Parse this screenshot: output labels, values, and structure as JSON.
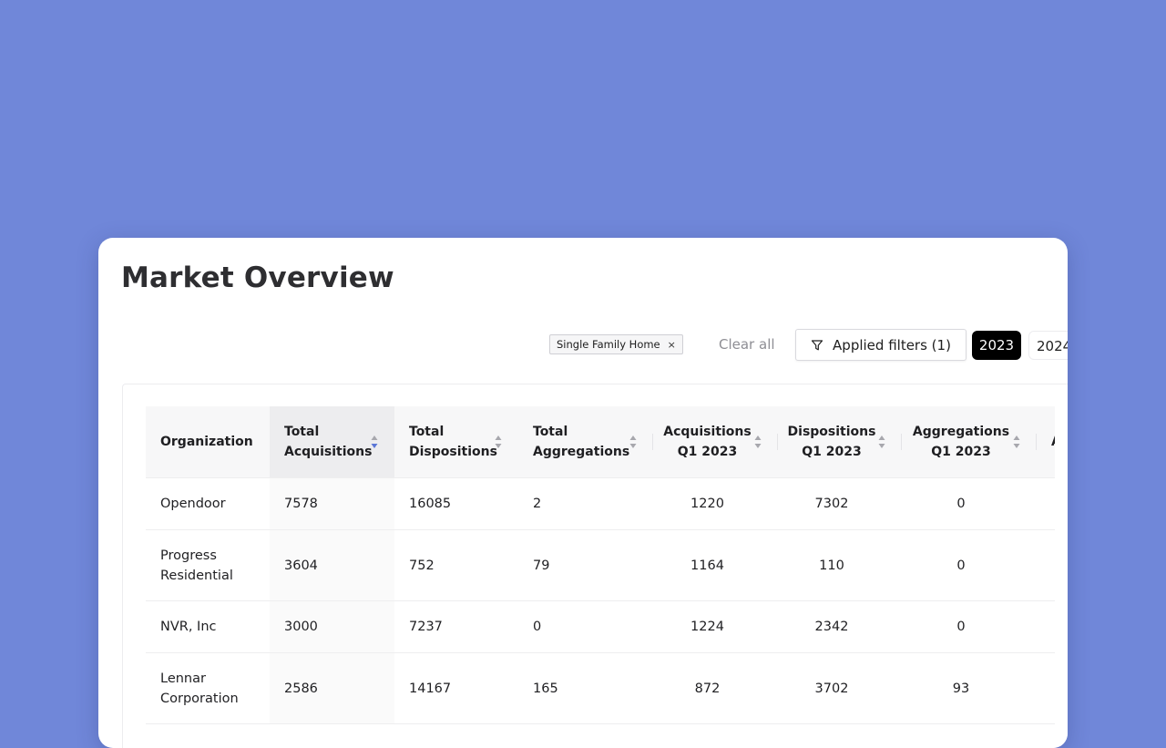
{
  "page": {
    "title": "Market Overview"
  },
  "filters": {
    "chip_label": "Single Family Home",
    "chip_close": "×",
    "clear_all": "Clear all",
    "applied_label": "Applied filters (1)"
  },
  "years": {
    "active": "2023",
    "other": "2024"
  },
  "table": {
    "columns": [
      {
        "label_lines": [
          "Organization"
        ],
        "sortable": false,
        "sorted": false,
        "align": "left"
      },
      {
        "label_lines": [
          "Total",
          "Acquisitions"
        ],
        "sortable": true,
        "sorted": true,
        "align": "left"
      },
      {
        "label_lines": [
          "Total",
          "Dispositions"
        ],
        "sortable": true,
        "sorted": false,
        "align": "left"
      },
      {
        "label_lines": [
          "Total",
          "Aggregations"
        ],
        "sortable": true,
        "sorted": false,
        "align": "left"
      },
      {
        "label_lines": [
          "Acquisitions",
          "Q1 2023"
        ],
        "sortable": true,
        "sorted": false,
        "align": "center"
      },
      {
        "label_lines": [
          "Dispositions",
          "Q1 2023"
        ],
        "sortable": true,
        "sorted": false,
        "align": "center"
      },
      {
        "label_lines": [
          "Aggregations",
          "Q1 2023"
        ],
        "sortable": true,
        "sorted": false,
        "align": "center"
      },
      {
        "label_lines": [
          "A"
        ],
        "sortable": true,
        "sorted": false,
        "align": "left"
      }
    ],
    "rows": [
      {
        "organization": [
          "Opendoor"
        ],
        "values": [
          "7578",
          "16085",
          "2",
          "1220",
          "7302",
          "0",
          ""
        ]
      },
      {
        "organization": [
          "Progress",
          "Residential"
        ],
        "values": [
          "3604",
          "752",
          "79",
          "1164",
          "110",
          "0",
          ""
        ]
      },
      {
        "organization": [
          "NVR, Inc"
        ],
        "values": [
          "3000",
          "7237",
          "0",
          "1224",
          "2342",
          "0",
          ""
        ]
      },
      {
        "organization": [
          "Lennar",
          "Corporation"
        ],
        "values": [
          "2586",
          "14167",
          "165",
          "872",
          "3702",
          "93",
          ""
        ]
      }
    ]
  },
  "colors": {
    "background": "#7087d9",
    "sort_active": "#5b76d6",
    "sort_inactive": "#a7a7ad",
    "year_active_bg": "#000000"
  },
  "icons": {
    "filter": "filter-icon",
    "close": "close-icon",
    "sort": "sort-icon"
  }
}
